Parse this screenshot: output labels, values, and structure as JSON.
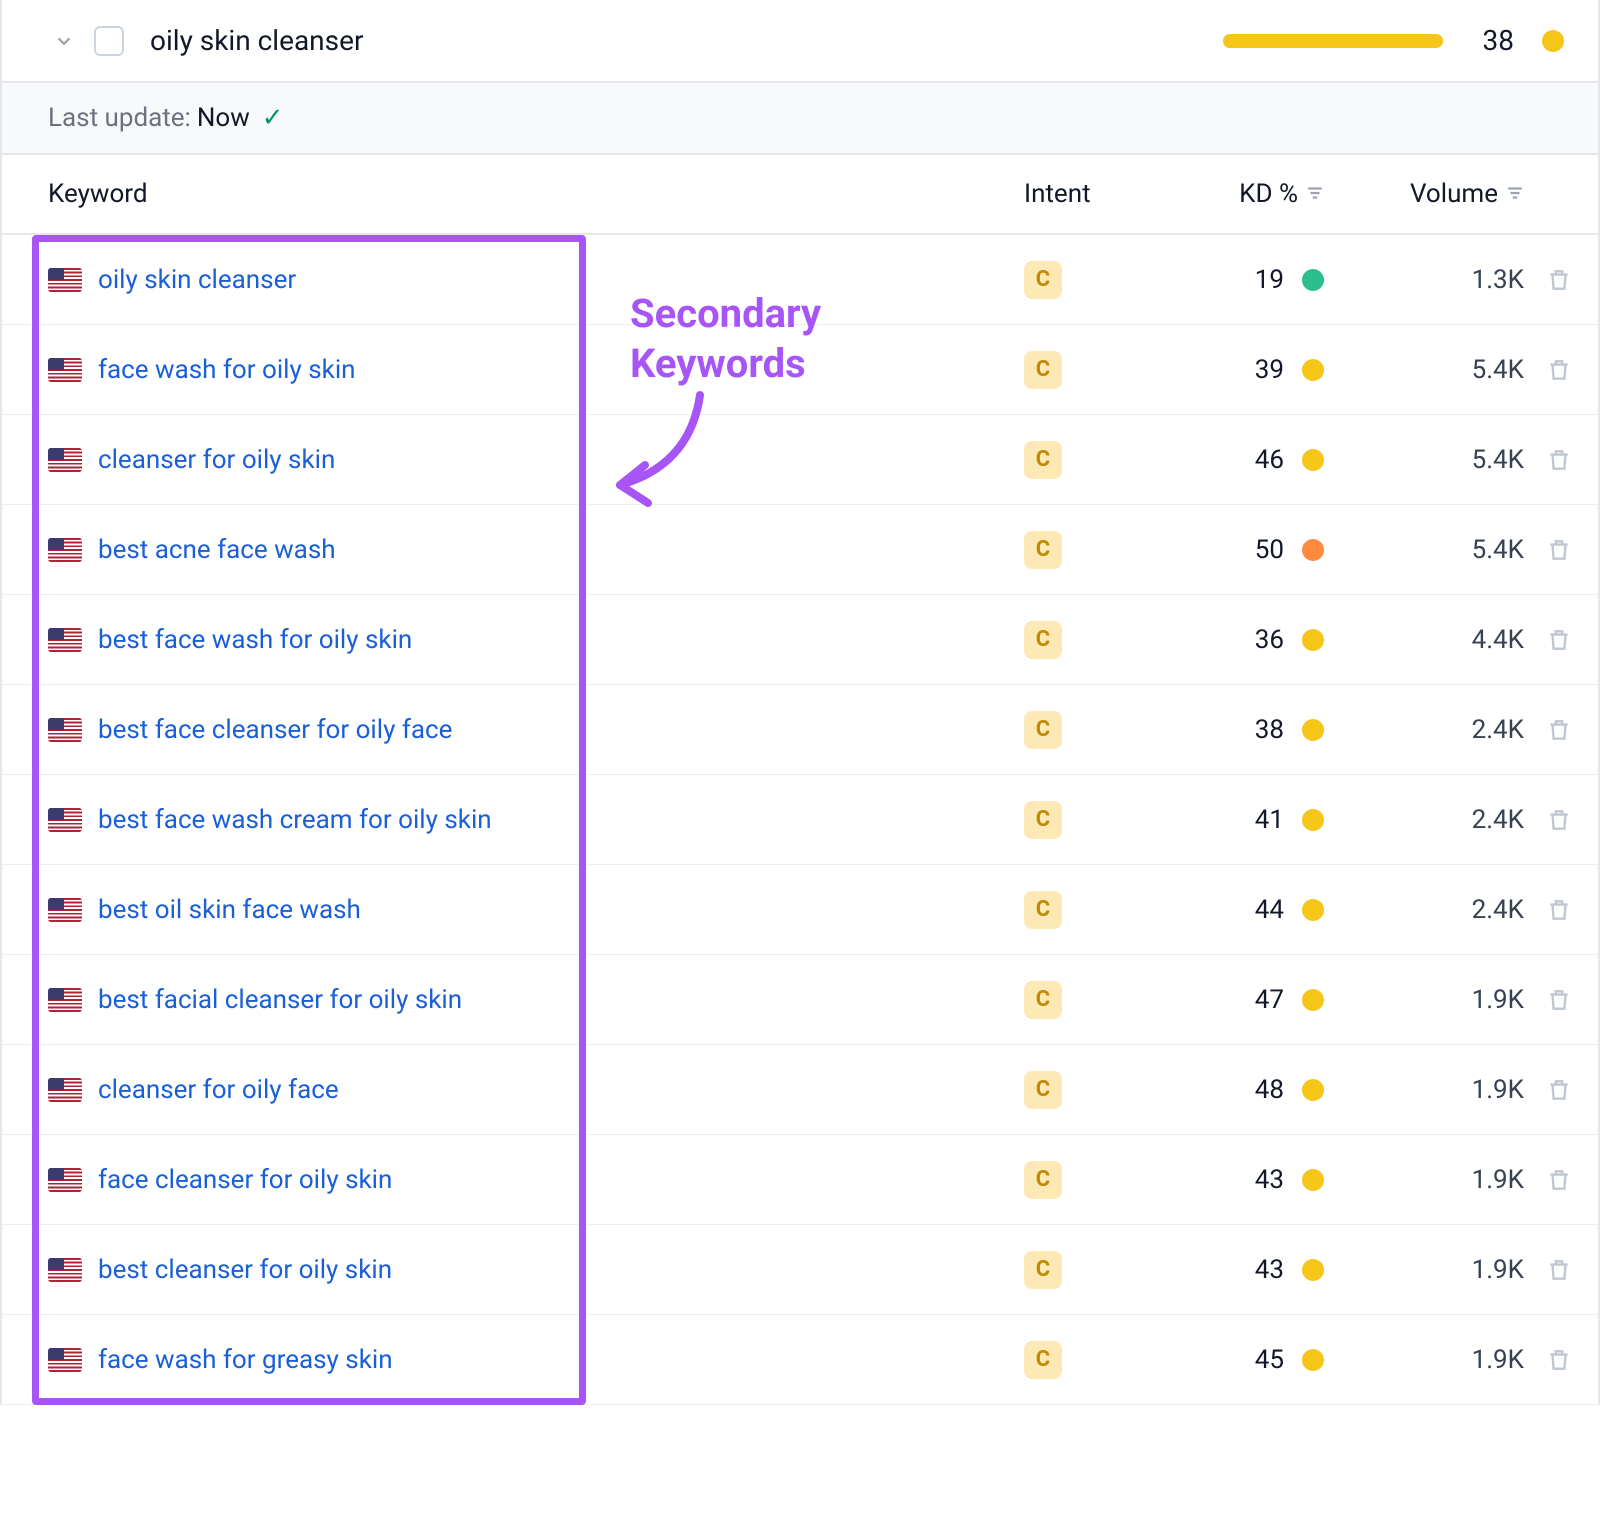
{
  "header": {
    "title": "oily skin cleanser",
    "score": "38",
    "score_dot_color": "yellow"
  },
  "update_strip": {
    "label": "Last update:",
    "value": "Now"
  },
  "columns": {
    "keyword": "Keyword",
    "intent": "Intent",
    "kd": "KD %",
    "volume": "Volume"
  },
  "intent_badge": "C",
  "annotation": {
    "line1": "Secondary",
    "line2": "Keywords"
  },
  "rows": [
    {
      "keyword": "oily skin cleanser",
      "kd": "19",
      "kd_color": "green",
      "volume": "1.3K"
    },
    {
      "keyword": "face wash for oily skin",
      "kd": "39",
      "kd_color": "yellow",
      "volume": "5.4K"
    },
    {
      "keyword": "cleanser for oily skin",
      "kd": "46",
      "kd_color": "yellow",
      "volume": "5.4K"
    },
    {
      "keyword": "best acne face wash",
      "kd": "50",
      "kd_color": "orange",
      "volume": "5.4K"
    },
    {
      "keyword": "best face wash for oily skin",
      "kd": "36",
      "kd_color": "yellow",
      "volume": "4.4K"
    },
    {
      "keyword": "best face cleanser for oily face",
      "kd": "38",
      "kd_color": "yellow",
      "volume": "2.4K"
    },
    {
      "keyword": "best face wash cream for oily skin",
      "kd": "41",
      "kd_color": "yellow",
      "volume": "2.4K"
    },
    {
      "keyword": "best oil skin face wash",
      "kd": "44",
      "kd_color": "yellow",
      "volume": "2.4K"
    },
    {
      "keyword": "best facial cleanser for oily skin",
      "kd": "47",
      "kd_color": "yellow",
      "volume": "1.9K"
    },
    {
      "keyword": "cleanser for oily face",
      "kd": "48",
      "kd_color": "yellow",
      "volume": "1.9K"
    },
    {
      "keyword": "face cleanser for oily skin",
      "kd": "43",
      "kd_color": "yellow",
      "volume": "1.9K"
    },
    {
      "keyword": "best cleanser for oily skin",
      "kd": "43",
      "kd_color": "yellow",
      "volume": "1.9K"
    },
    {
      "keyword": "face wash for greasy skin",
      "kd": "45",
      "kd_color": "yellow",
      "volume": "1.9K"
    }
  ]
}
